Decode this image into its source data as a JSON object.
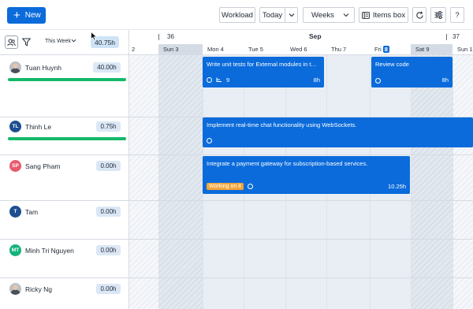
{
  "toolbar": {
    "new_label": "New",
    "workload_label": "Workload",
    "today_label": "Today",
    "view_label": "Weeks",
    "items_box_label": "Items box",
    "help_label": "?"
  },
  "header": {
    "period_label": "This Week",
    "total_hours": "40.75h",
    "month": "Sep",
    "weeks": [
      "36",
      "37"
    ],
    "days": [
      "2",
      "Sun 3",
      "Mon 4",
      "Tue 5",
      "Wed 6",
      "Thu 7",
      "Fri",
      "Sat 9",
      "Sun 1"
    ],
    "today_number": "8"
  },
  "people": [
    {
      "name": "Tuan Huynh",
      "hours": "40.00h",
      "initials": "",
      "avatar_color": "#b8c0ca",
      "load": 1
    },
    {
      "name": "Thinh Le",
      "hours": "0.75h",
      "initials": "TL",
      "avatar_color": "#1c4f8f",
      "load": 1
    },
    {
      "name": "Sang Pham",
      "hours": "0.00h",
      "initials": "SP",
      "avatar_color": "#e75a6e"
    },
    {
      "name": "Tam",
      "hours": "0.00h",
      "initials": "T",
      "avatar_color": "#1c4f8f"
    },
    {
      "name": "Minh Tri Nguyen",
      "hours": "0.00h",
      "initials": "MT",
      "avatar_color": "#13b37a"
    },
    {
      "name": "Ricky Ng",
      "hours": "0.00h",
      "initials": "",
      "avatar_color": "#b8c0ca"
    }
  ],
  "tasks": [
    {
      "title": "Write unit tests for External modules in the a...",
      "hours": "8h",
      "subtasks": "9"
    },
    {
      "title": "Review code",
      "hours": "8h"
    },
    {
      "title": "Implement real-time chat functionality using WebSockets."
    },
    {
      "title": "Integrate a payment gateway for subscription-based services.",
      "hours": "10.25h",
      "status": "Working on it"
    }
  ],
  "colors": {
    "accent": "#0b6bdb",
    "load_bar": "#14b86a",
    "status_working": "#f2a43a"
  }
}
